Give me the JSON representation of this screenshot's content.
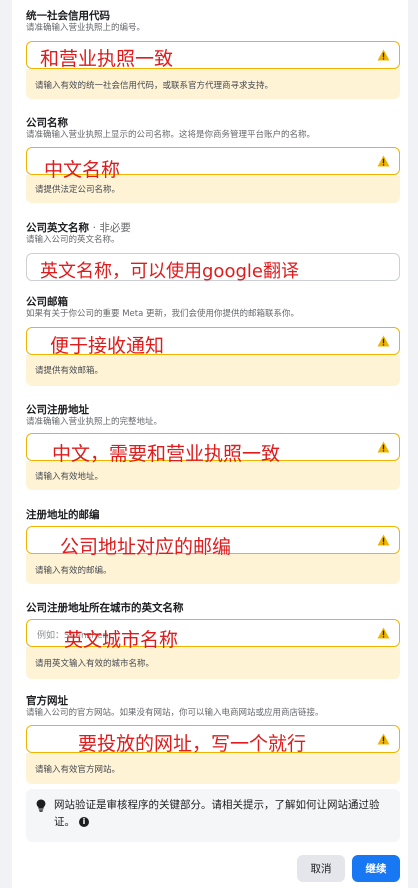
{
  "sections": [
    {
      "key": "credit",
      "title": "统一社会信用代码",
      "desc": "请准确输入营业执照上的编号。",
      "warning": "请输入有效的统一社会信用代码，或联系官方代理商寻求支持。",
      "note": "和营业执照一致"
    },
    {
      "key": "company_name",
      "title": "公司名称",
      "desc": "请准确输入营业执照上显示的公司名称。这将是你商务管理平台账户的名称。",
      "warning": "请提供法定公司名称。",
      "note": "中文名称"
    },
    {
      "key": "english_name",
      "title": "公司英文名称",
      "optional": "· 非必要",
      "desc": "请输入公司的英文名称。",
      "note": "英文名称，可以使用google翻译"
    },
    {
      "key": "email",
      "title": "公司邮箱",
      "desc": "如果有关于你公司的重要 Meta 更新，我们会使用你提供的邮箱联系你。",
      "warning": "请提供有效邮箱。",
      "note": "便于接收通知"
    },
    {
      "key": "address",
      "title": "公司注册地址",
      "desc": "请准确输入营业执照上的完整地址。",
      "warning": "请输入有效地址。",
      "note": "中文，需要和营业执照一致"
    },
    {
      "key": "postal",
      "title": "注册地址的邮编",
      "warning": "请输入有效的邮编。",
      "note": "公司地址对应的邮编"
    },
    {
      "key": "city",
      "title": "公司注册地址所在城市的英文名称",
      "placeholder": "例如：Shenzhen",
      "warning": "请用英文输入有效的城市名称。",
      "note": "英文城市名称"
    },
    {
      "key": "website",
      "title": "官方网址",
      "desc": "请输入公司的官方网站。如果没有网站，你可以输入电商网站或应用商店链接。",
      "warning": "请输入有效官方网站。",
      "note": "要投放的网址，写一个就行"
    }
  ],
  "tip": {
    "icon": "lightbulb-icon",
    "text": "网站验证是审核程序的关键部分。请相关提示，了解如何让网站通过验证。"
  },
  "buttons": {
    "cancel": "取消",
    "continue": "继续"
  },
  "colors": {
    "warning_border": "#f0b400",
    "warning_bg": "#fff3d6",
    "annotation_red": "#e01b1b",
    "primary": "#1877f2"
  }
}
